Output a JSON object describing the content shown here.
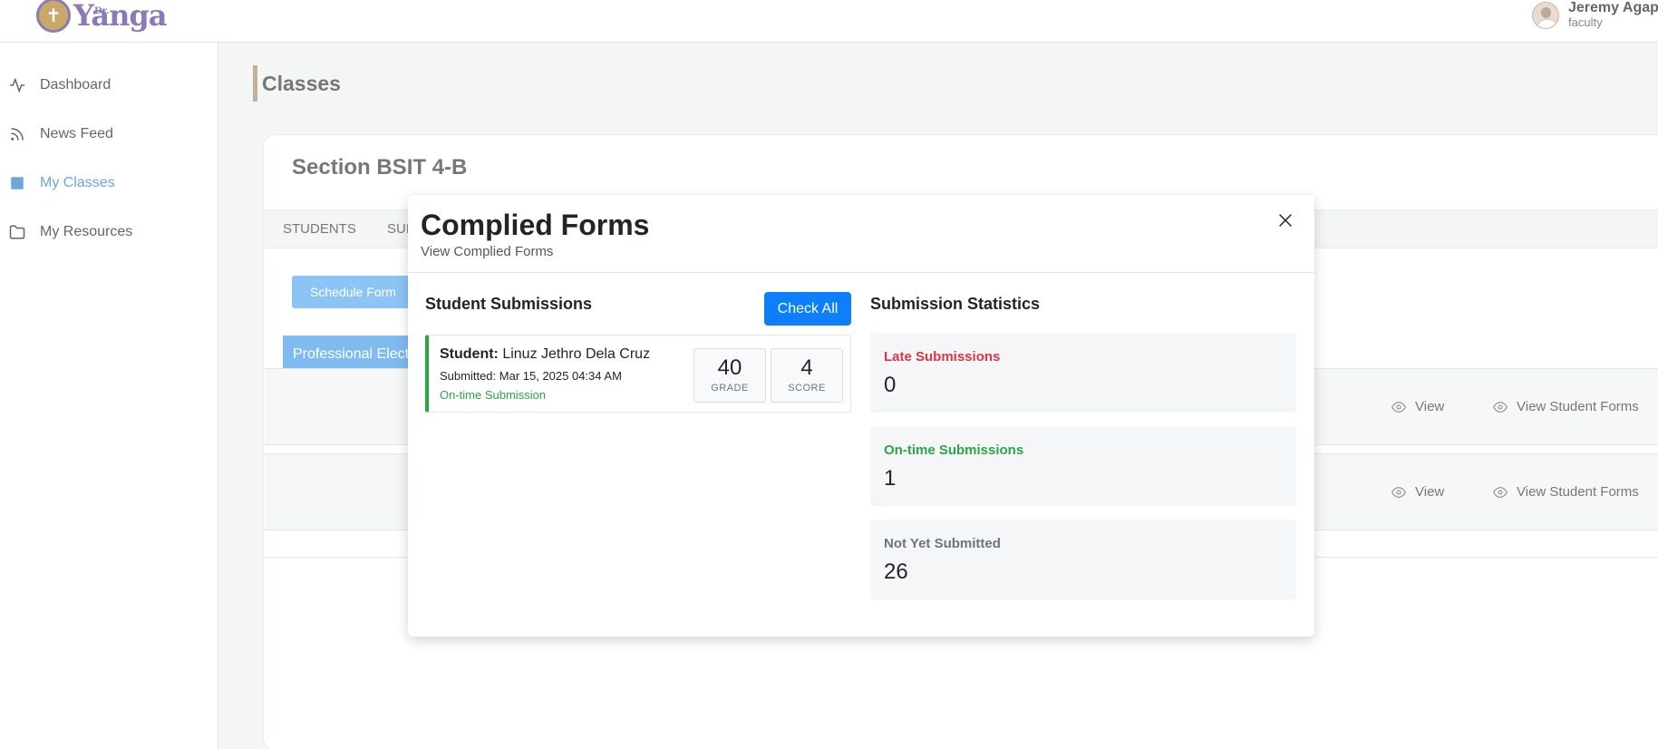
{
  "brand": {
    "logo_small": "Dr.",
    "logo_text": "Yanga"
  },
  "user": {
    "name": "Jeremy Agap",
    "role": "faculty"
  },
  "sidebar": {
    "items": [
      {
        "label": "Dashboard",
        "icon": "activity-icon"
      },
      {
        "label": "News Feed",
        "icon": "rss-icon"
      },
      {
        "label": "My Classes",
        "icon": "square-icon",
        "active": true
      },
      {
        "label": "My Resources",
        "icon": "folder-icon"
      }
    ]
  },
  "page": {
    "title": "Classes"
  },
  "section": {
    "title": "Section BSIT 4-B",
    "tabs": [
      "STUDENTS",
      "SUF"
    ],
    "schedule_button": "Schedule Form",
    "category_label": "Professional Electi",
    "rows": [
      {
        "view_label": "View",
        "view_forms_label": "View Student Forms"
      },
      {
        "view_label": "View",
        "view_forms_label": "View Student Forms"
      }
    ]
  },
  "modal": {
    "title": "Complied Forms",
    "subtitle": "View Complied Forms",
    "submissions_title": "Student Submissions",
    "check_all_label": "Check All",
    "submission": {
      "student_label": "Student:",
      "student_name": "Linuz Jethro Dela Cruz",
      "submitted": "Submitted: Mar 15, 2025 04:34 AM",
      "status": "On-time Submission",
      "grade_value": "40",
      "grade_label": "GRADE",
      "score_value": "4",
      "score_label": "SCORE"
    },
    "stats_title": "Submission Statistics",
    "stats": [
      {
        "label": "Late Submissions",
        "value": "0",
        "color": "#dc3545"
      },
      {
        "label": "On-time Submissions",
        "value": "1",
        "color": "#28a745"
      },
      {
        "label": "Not Yet Submitted",
        "value": "26",
        "color": "#6c757d"
      }
    ]
  },
  "colors": {
    "accent": "#0d7ffb",
    "active_nav": "#6aa8d8",
    "brand": "#8a7bb8",
    "success": "#28a745",
    "danger": "#dc3545"
  }
}
